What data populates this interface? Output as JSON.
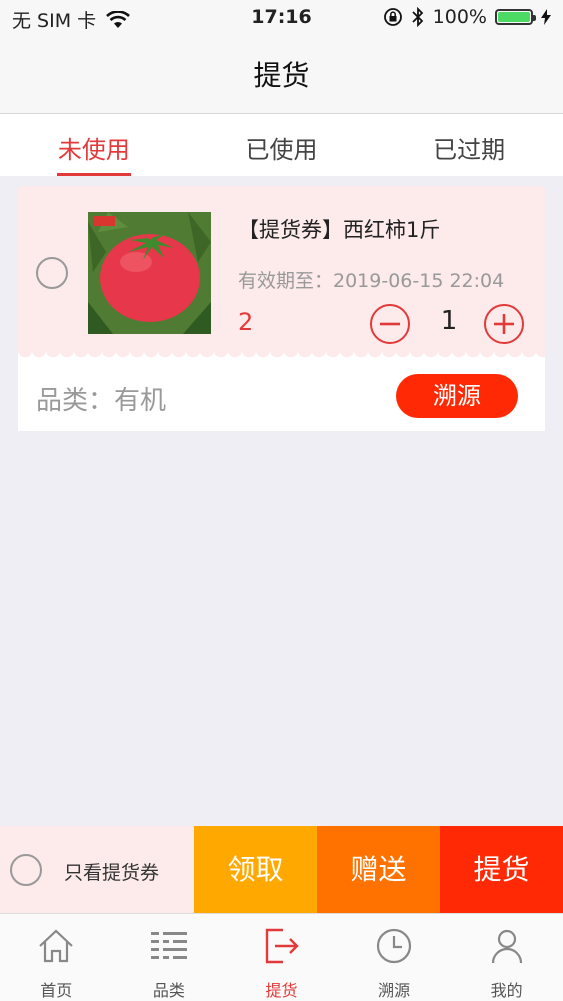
{
  "status_bar": {
    "carrier": "无 SIM 卡",
    "time": "17:16",
    "battery": "100%"
  },
  "nav": {
    "title": "提货"
  },
  "tabs": [
    {
      "label": "未使用",
      "active": true
    },
    {
      "label": "已使用",
      "active": false
    },
    {
      "label": "已过期",
      "active": false
    }
  ],
  "coupon": {
    "name": "【提货券】西红柿1斤",
    "expiry": "有效期至：2019-06-15 22:04",
    "count": "2",
    "quantity": "1",
    "category": "品类：有机",
    "trace_button": "溯源"
  },
  "action_bar": {
    "only_coupon_label": "只看提货券",
    "receive": "领取",
    "gift": "赠送",
    "pickup": "提货"
  },
  "tab_bar": [
    {
      "label": "首页",
      "icon": "home-icon",
      "active": false
    },
    {
      "label": "品类",
      "icon": "category-icon",
      "active": false
    },
    {
      "label": "提货",
      "icon": "pickup-icon",
      "active": true
    },
    {
      "label": "溯源",
      "icon": "clock-icon",
      "active": false
    },
    {
      "label": "我的",
      "icon": "user-icon",
      "active": false
    }
  ],
  "colors": {
    "accent": "#e23a3a",
    "receive": "#ffa800",
    "gift": "#ff7200",
    "pickup": "#ff2a05"
  }
}
